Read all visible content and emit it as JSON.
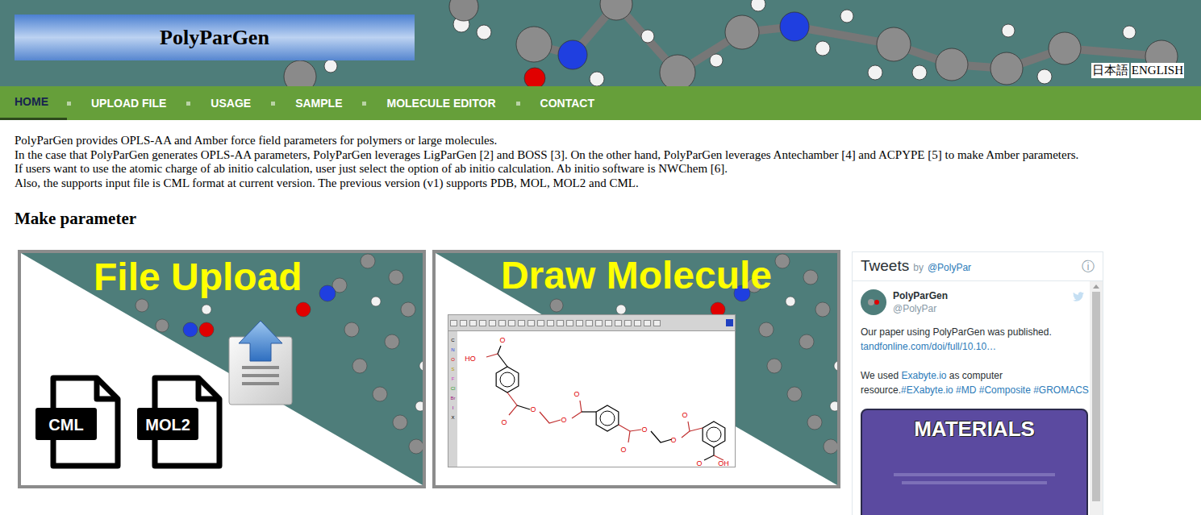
{
  "header": {
    "title": "PolyParGen",
    "languages": [
      {
        "label": "日本語"
      },
      {
        "label": "ENGLISH"
      }
    ]
  },
  "nav": {
    "items": [
      {
        "label": "HOME",
        "selected": true
      },
      {
        "label": "UPLOAD FILE",
        "selected": false
      },
      {
        "label": "USAGE",
        "selected": false
      },
      {
        "label": "SAMPLE",
        "selected": false
      },
      {
        "label": "MOLECULE EDITOR",
        "selected": false
      },
      {
        "label": "CONTACT",
        "selected": false
      }
    ]
  },
  "intro": [
    "PolyParGen provides OPLS-AA and Amber force field parameters for polymers or large molecules.",
    "In the case that PolyParGen generates OPLS-AA parameters, PolyParGen leverages LigParGen [2] and BOSS [3]. On the other hand, PolyParGen leverages Antechamber [4] and ACPYPE [5] to make Amber parameters.",
    "If users want to use the atomic charge of ab initio calculation, user just select the option of ab initio calculation. Ab initio software is NWChem [6].",
    "Also, the supports input file is CML format at current version. The previous version (v1) supports PDB, MOL, MOL2 and CML."
  ],
  "section": {
    "heading": "Make parameter"
  },
  "cards": [
    {
      "kind": "upload",
      "title": "File Upload",
      "files": [
        "CML",
        "MOL2"
      ]
    },
    {
      "kind": "editor",
      "title": "Draw Molecule",
      "elements": [
        {
          "label": "C",
          "color": "#000000"
        },
        {
          "label": "N",
          "color": "#1f3fe0"
        },
        {
          "label": "O",
          "color": "#e00000"
        },
        {
          "label": "S",
          "color": "#b8a000"
        },
        {
          "label": "F",
          "color": "#d040c0"
        },
        {
          "label": "Cl",
          "color": "#20a020"
        },
        {
          "label": "Br",
          "color": "#a02080"
        },
        {
          "label": "I",
          "color": "#a000a0"
        },
        {
          "label": "X",
          "color": "#000000"
        }
      ],
      "atoms": [
        "O",
        "HO",
        "O",
        "O",
        "O",
        "O",
        "O",
        "O",
        "O",
        "O",
        "O",
        "OH"
      ]
    }
  ],
  "tweets": {
    "title": "Tweets",
    "by": "by",
    "handle": "@PolyPar",
    "info": "ⓘ",
    "tweet": {
      "name": "PolyParGen",
      "handle": "@PolyPar",
      "paragraphs": [
        [
          [
            {
              "text": "Our paper using PolyParGen was published.",
              "link": false
            }
          ],
          [
            {
              "text": "tandfonline.com/doi/full/10.10…",
              "link": true
            }
          ]
        ],
        [
          [
            {
              "text": "We used ",
              "link": false
            },
            {
              "text": "Exabyte.io",
              "link": true
            },
            {
              "text": " as computer resource.",
              "link": false
            },
            {
              "text": "#EXabyte.io",
              "link": true
            },
            {
              "text": " ",
              "link": false
            },
            {
              "text": "#MD",
              "link": true
            },
            {
              "text": " ",
              "link": false
            },
            {
              "text": "#Composite",
              "link": true
            },
            {
              "text": " ",
              "link": false
            },
            {
              "text": "#GROMACS",
              "link": true
            }
          ]
        ]
      ],
      "media": {
        "title": "MATERIALS"
      }
    }
  }
}
